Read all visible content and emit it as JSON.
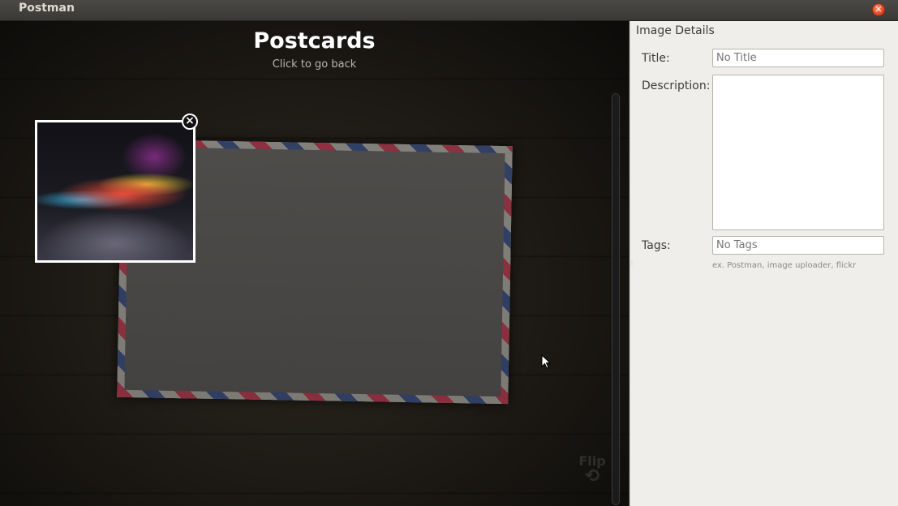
{
  "window": {
    "title": "Postman",
    "close_icon": "close-icon"
  },
  "stage": {
    "heading": "Postcards",
    "subheading": "Click to go back",
    "flip_label": "Flip",
    "flip_icon": "rotate-icon"
  },
  "panel": {
    "title": "Image Details",
    "title_label": "Title:",
    "title_placeholder": "No Title",
    "description_label": "Description:",
    "description_value": "",
    "tags_label": "Tags:",
    "tags_placeholder": "No Tags",
    "tags_hint": "ex. Postman, image uploader, flickr"
  }
}
